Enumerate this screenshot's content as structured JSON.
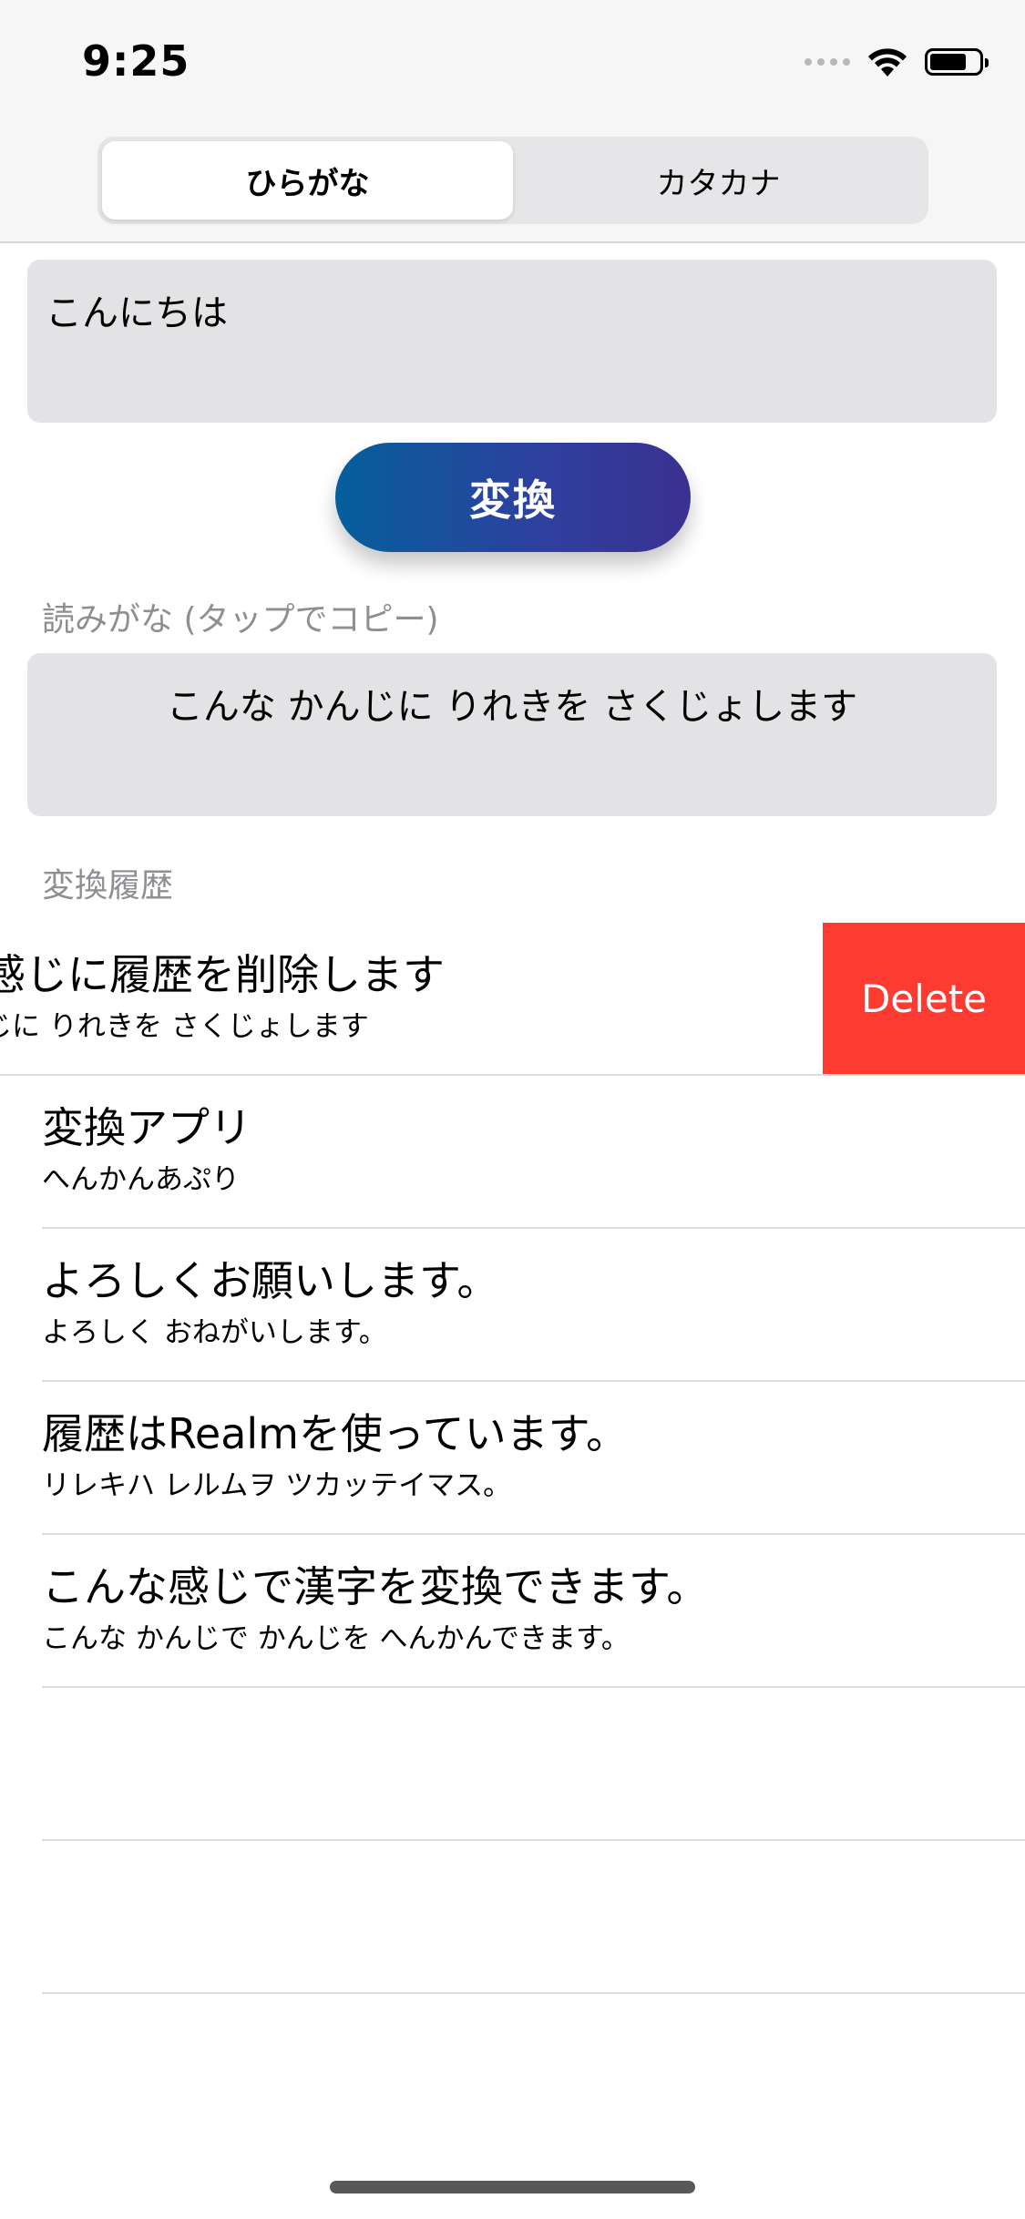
{
  "status_bar": {
    "time": "9:25",
    "icons": [
      "signal-icon",
      "wifi-icon",
      "battery-icon"
    ]
  },
  "mode_selector": {
    "segments": [
      {
        "label": "ひらがな",
        "selected": true
      },
      {
        "label": "カタカナ",
        "selected": false
      }
    ]
  },
  "input": {
    "value": "こんにちは"
  },
  "convert_button": {
    "label": "変換",
    "gradient_start": "#055f9c",
    "gradient_end": "#3a3191"
  },
  "reading": {
    "label": "読みがな (タップでコピー)",
    "value": "こんな かんじに りれきを さくじょします"
  },
  "history": {
    "label": "変換履歴",
    "items": [
      {
        "text": "感じに履歴を削除します",
        "reading": "じに りれきを さくじょします",
        "swiped": true,
        "action": "Delete"
      },
      {
        "text": "変換アプリ",
        "reading": "へんかんあぷり"
      },
      {
        "text": "よろしくお願いします。",
        "reading": "よろしく おねがいします。"
      },
      {
        "text": "履歴はRealmを使っています。",
        "reading": "リレキハ レルムヲ ツカッテイマス。"
      },
      {
        "text": "こんな感じで漢字を変換できます。",
        "reading": "こんな かんじで かんじを へんかんできます。"
      }
    ]
  },
  "colors": {
    "delete": "#fe3b30",
    "field_background": "#e3e3e5",
    "secondary_text": "#8e8e93"
  }
}
